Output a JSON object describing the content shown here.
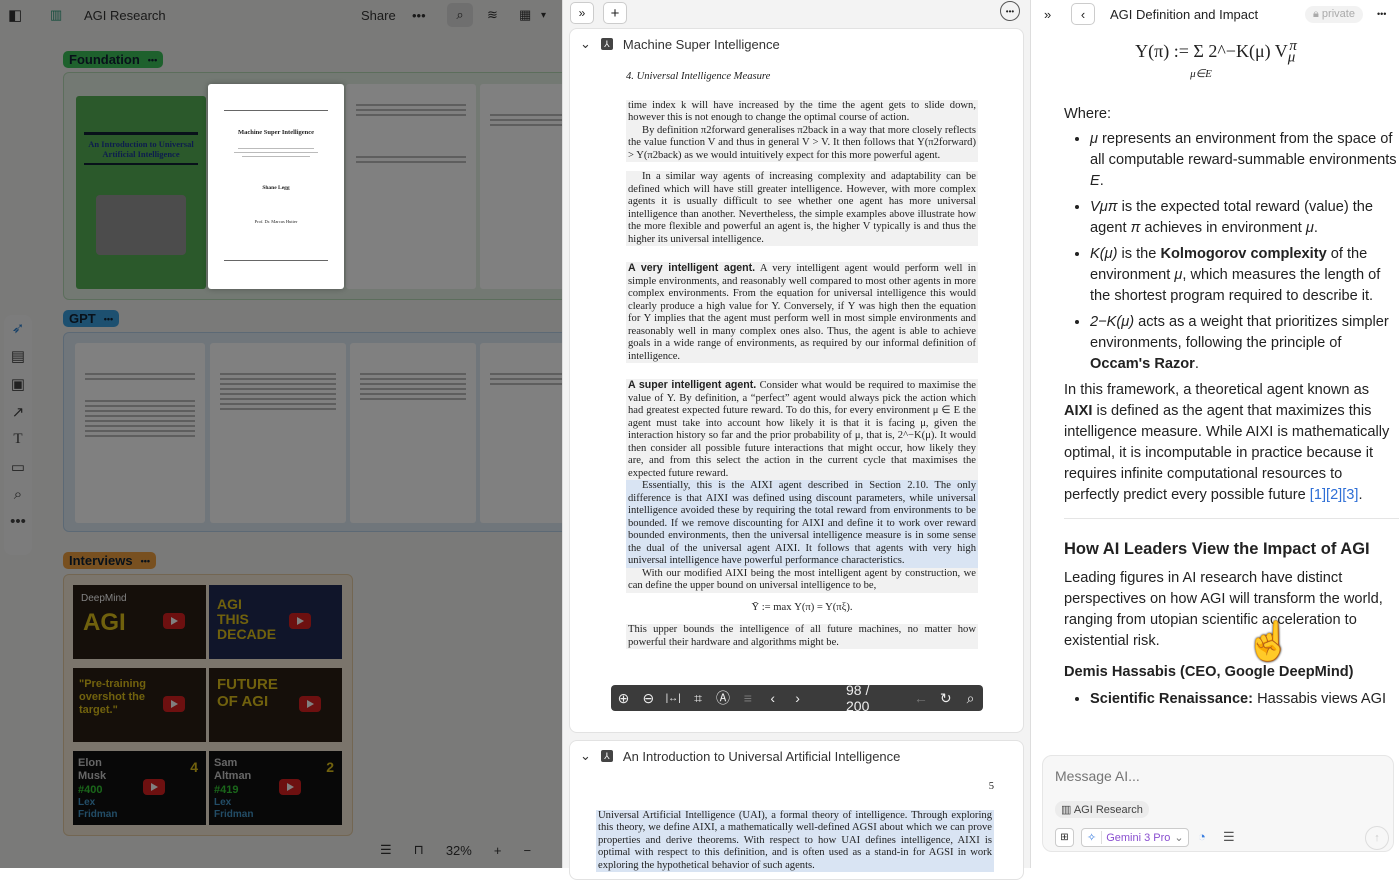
{
  "left": {
    "title": "AGI Research",
    "share": "Share",
    "more": "•••",
    "groups": [
      {
        "name": "Foundation",
        "color": "#3cc15a"
      },
      {
        "name": "GPT",
        "color": "#3aa0e0"
      },
      {
        "name": "Interviews",
        "color": "#f0a040"
      }
    ],
    "covers": {
      "uai_title": "An Introduction to Universal Artificial Intelligence",
      "msi_title": "Machine Super Intelligence",
      "msi_author": "Shane Legg",
      "msi_supervisor": "Prof. Dr. Marcus Hutter"
    },
    "videos": [
      {
        "brand": "DeepMind",
        "text": "AGI"
      },
      {
        "text": "AGI THIS DECADE"
      },
      {
        "text": "\"Pre-training overshot the target.\""
      },
      {
        "text": "FUTURE OF AGI"
      },
      {
        "text": "Elon Musk",
        "num": "#400",
        "host": "Lex Fridman",
        "round": "4"
      },
      {
        "text": "Sam Altman",
        "num": "#419",
        "host": "Lex Fridman",
        "round": "2"
      }
    ],
    "zoom": "32%"
  },
  "mid": {
    "doc1": "Machine Super Intelligence",
    "doc2": "An Introduction to Universal Artificial Intelligence",
    "running_head": "4. Universal Intelligence Measure",
    "p1": "time index k will have increased by the time the agent gets to slide down, however this is not enough to change the optimal course of action.",
    "p2": "By definition π2forward generalises π2back in a way that more closely reflects the value function V and thus in general V > V. It then follows that Υ(π2forward) > Υ(π2back) as we would intuitively expect for this more powerful agent.",
    "p3": "In a similar way agents of increasing complexity and adaptability can be defined which will have still greater intelligence. However, with more complex agents it is usually difficult to see whether one agent has more universal intelligence than another. Nevertheless, the simple examples above illustrate how the more flexible and powerful an agent is, the higher V typically is and thus the higher its universal intelligence.",
    "h4": "A very intelligent agent.",
    "p4": "A very intelligent agent would perform well in simple environments, and reasonably well compared to most other agents in more complex environments. From the equation for universal intelligence this would clearly produce a high value for Υ. Conversely, if Υ was high then the equation for Υ implies that the agent must perform well in most simple environments and reasonably well in many complex ones also. Thus, the agent is able to achieve goals in a wide range of environments, as required by our informal definition of intelligence.",
    "h5": "A super intelligent agent.",
    "p5": "Consider what would be required to maximise the value of Υ. By definition, a “perfect” agent would always pick the action which had greatest expected future reward. To do this, for every environment μ ∈ E the agent must take into account how likely it is that it is facing μ, given the interaction history so far and the prior probability of μ, that is, 2^−K(μ). It would then consider all possible future interactions that might occur, how likely they are, and from this select the action in the current cycle that maximises the expected future reward.",
    "p6": "Essentially, this is the AIXI agent described in Section 2.10. The only difference is that AIXI was defined using discount parameters, while universal intelligence avoided these by requiring the total reward from environments to be bounded. If we remove discounting for AIXI and define it to work over reward bounded environments, then the universal intelligence measure is in some sense the dual of the universal agent AIXI. It follows that agents with very high universal intelligence have powerful performance characteristics.",
    "p7": "With our modified AIXI being the most intelligent agent by construction, we can define the upper bound on universal intelligence to be,",
    "eq": "Ῡ := max Υ(π) = Υ(πξ).",
    "p8": "This upper bounds the intelligence of all future machines, no matter how powerful their hardware and algorithms might be.",
    "page_indicator": "98 / 200",
    "page_num2": "5",
    "p9": "Universal Artificial Intelligence (UAI), a formal theory of intelligence. Through exploring this theory, we define AIXI, a mathematically well-defined AGSI about which we can prove properties and derive theorems. With respect to how UAI defines intelligence, AIXI is optimal with respect to this definition, and is often used as a stand-in for AGSI in work exploring the hypothetical behavior of such agents."
  },
  "right": {
    "title": "AGI Definition and Impact",
    "privacy": "private",
    "formula": "Υ(π) := Σ 2^−K(μ) V",
    "formula_sub": "μ∈E",
    "where": "Where:",
    "b1": {
      "sym": "μ",
      "text": " represents an environment from the space of all computable reward-summable environments ",
      "sym2": "E",
      "end": "."
    },
    "b2": {
      "sym": "Vμπ",
      "text": " is the expected total reward (value) the agent ",
      "sym2": "π",
      "text2": " achieves in environment ",
      "sym3": "μ",
      "end": "."
    },
    "b3": {
      "sym": "K(μ)",
      "text": " is the ",
      "bold": "Kolmogorov complexity",
      "text2": " of the environment ",
      "sym2": "μ",
      "text3": ", which measures the length of the shortest program required to describe it."
    },
    "b4": {
      "sym": "2−K(μ)",
      "text": " acts as a weight that prioritizes simpler environments, following the principle of ",
      "bold": "Occam's Razor",
      "end": "."
    },
    "para1_a": "In this framework, a theoretical agent known as ",
    "para1_bold": "AIXI",
    "para1_b": " is defined as the agent that maximizes this intelligence measure. While AIXI is mathematically optimal, it is incomputable in practice because it requires infinite computational resources to perfectly predict every possible future ",
    "cites": [
      "[1]",
      "[2]",
      "[3]"
    ],
    "heading": "How AI Leaders View the Impact of AGI",
    "para2": "Leading figures in AI research have distinct perspectives on how AGI will transform the world, ranging from utopian scientific acceleration to existential risk.",
    "subheading": "Demis Hassabis (CEO, Google DeepMind)",
    "b5_bold": "Scientific Renaissance:",
    "b5": " Hassabis views AGI",
    "chat": {
      "placeholder": "Message AI...",
      "context": "AGI Research",
      "model": "Gemini 3 Pro"
    },
    "accent": "#8a4fd0",
    "link": "#2f6fd6"
  }
}
